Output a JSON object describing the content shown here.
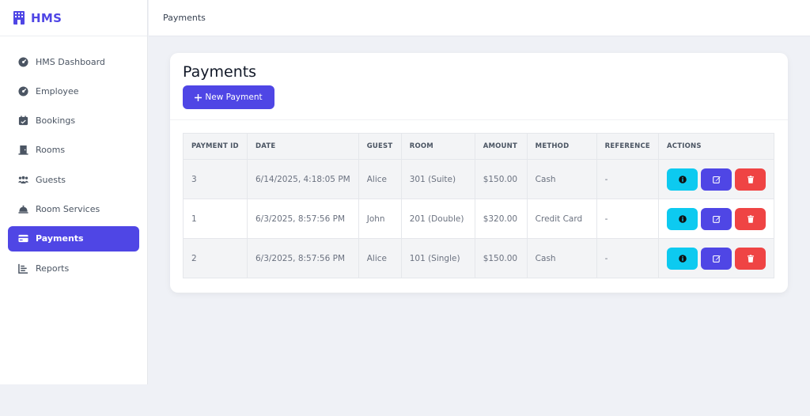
{
  "brand": {
    "name": "HMS",
    "color": "#4f46e5"
  },
  "sidebar": {
    "items": [
      {
        "label": "HMS Dashboard",
        "icon": "gauge-icon",
        "active": false
      },
      {
        "label": "Employee",
        "icon": "gauge-icon",
        "active": false
      },
      {
        "label": "Bookings",
        "icon": "calendar-check-icon",
        "active": false
      },
      {
        "label": "Rooms",
        "icon": "door-icon",
        "active": false
      },
      {
        "label": "Guests",
        "icon": "users-icon",
        "active": false
      },
      {
        "label": "Room Services",
        "icon": "bell-concierge-icon",
        "active": false
      },
      {
        "label": "Payments",
        "icon": "credit-card-icon",
        "active": true
      },
      {
        "label": "Reports",
        "icon": "chart-icon",
        "active": false
      }
    ]
  },
  "header": {
    "breadcrumb": "Payments"
  },
  "main": {
    "title": "Payments",
    "new_button": "New Payment",
    "table": {
      "columns": [
        "PAYMENT ID",
        "DATE",
        "GUEST",
        "ROOM",
        "AMOUNT",
        "METHOD",
        "REFERENCE",
        "ACTIONS"
      ],
      "rows": [
        {
          "id": "3",
          "date": "6/14/2025, 4:18:05 PM",
          "guest": "Alice",
          "room": "301 (Suite)",
          "amount": "$150.00",
          "method": "Cash",
          "reference": "-"
        },
        {
          "id": "1",
          "date": "6/3/2025, 8:57:56 PM",
          "guest": "John",
          "room": "201 (Double)",
          "amount": "$320.00",
          "method": "Credit Card",
          "reference": "-"
        },
        {
          "id": "2",
          "date": "6/3/2025, 8:57:56 PM",
          "guest": "Alice",
          "room": "101 (Single)",
          "amount": "$150.00",
          "method": "Cash",
          "reference": "-"
        }
      ]
    }
  },
  "colors": {
    "info": "#0dcaf0",
    "edit": "#4f46e5",
    "delete": "#ef4444"
  }
}
